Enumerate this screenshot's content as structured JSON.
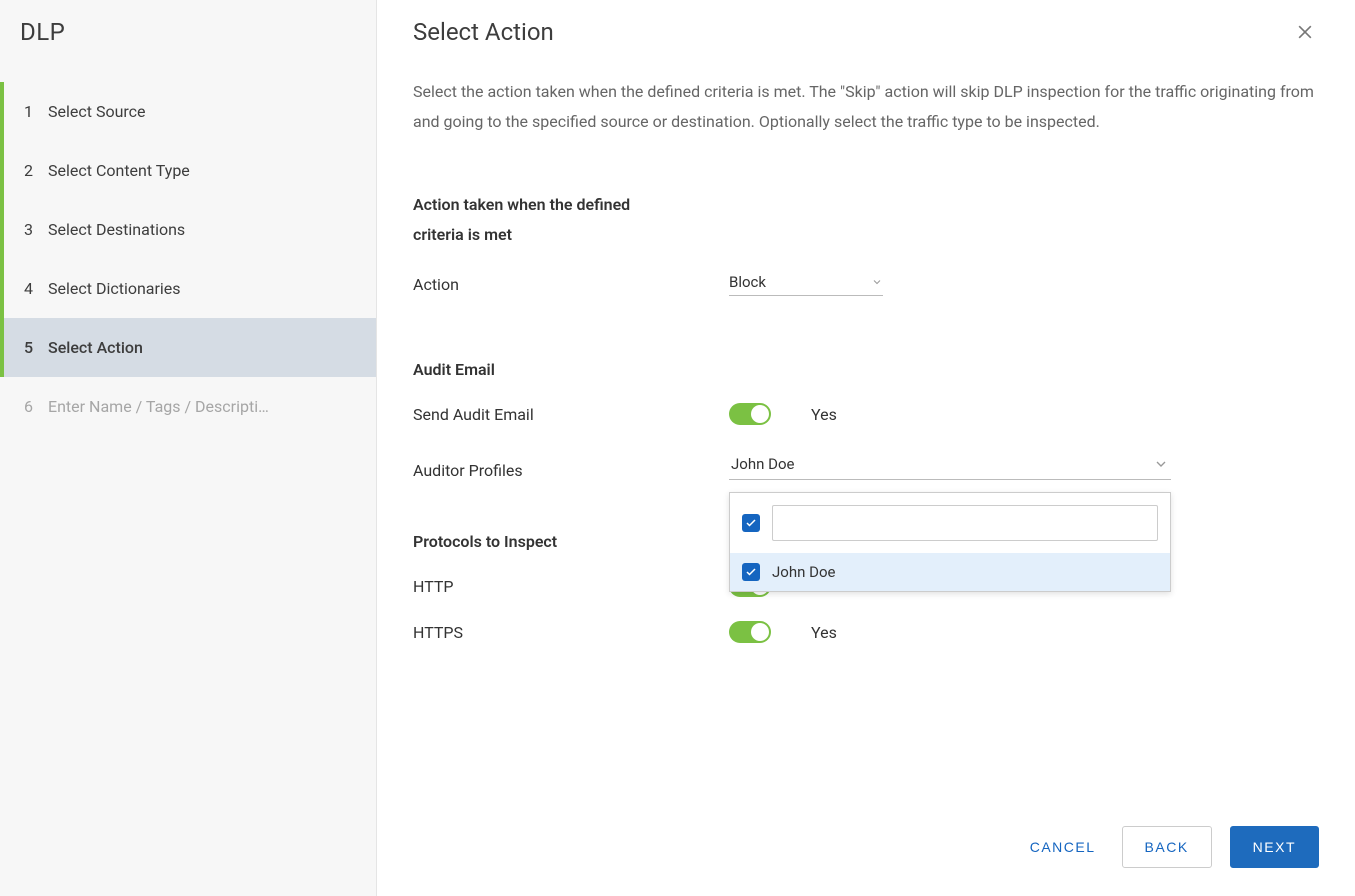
{
  "sidebar": {
    "title": "DLP",
    "steps": [
      {
        "num": "1",
        "label": "Select Source",
        "state": "completed"
      },
      {
        "num": "2",
        "label": "Select Content Type",
        "state": "completed"
      },
      {
        "num": "3",
        "label": "Select Destinations",
        "state": "completed"
      },
      {
        "num": "4",
        "label": "Select Dictionaries",
        "state": "completed"
      },
      {
        "num": "5",
        "label": "Select Action",
        "state": "active"
      },
      {
        "num": "6",
        "label": "Enter Name / Tags / Descripti…",
        "state": "disabled"
      }
    ]
  },
  "main": {
    "title": "Select Action",
    "description": "Select the action taken when the defined criteria is met. The \"Skip\" action will skip DLP inspection for the traffic originating from and going to the specified source or destination. Optionally select the traffic type to be inspected.",
    "sections": {
      "action": {
        "heading": "Action taken when the defined criteria is met",
        "label": "Action",
        "value": "Block"
      },
      "audit": {
        "heading": "Audit Email",
        "send_label": "Send Audit Email",
        "send_value": "Yes",
        "profiles_label": "Auditor Profiles",
        "profiles_value": "John Doe",
        "dropdown_option": "John Doe"
      },
      "protocols": {
        "heading": "Protocols to Inspect",
        "http_label": "HTTP",
        "http_value": "Yes",
        "https_label": "HTTPS",
        "https_value": "Yes"
      }
    }
  },
  "footer": {
    "cancel": "CANCEL",
    "back": "BACK",
    "next": "NEXT"
  }
}
